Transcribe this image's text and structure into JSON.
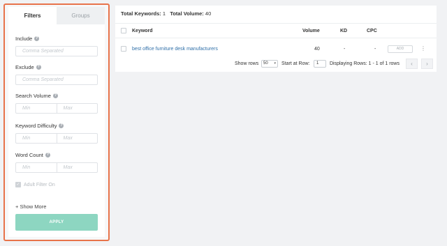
{
  "filters": {
    "tabs": [
      {
        "label": "Filters",
        "active": true
      },
      {
        "label": "Groups",
        "active": false
      }
    ],
    "include": {
      "label": "Include",
      "placeholder": "Comma Separated"
    },
    "exclude": {
      "label": "Exclude",
      "placeholder": "Comma Separated"
    },
    "search_volume": {
      "label": "Search Volume",
      "min": "Min",
      "max": "Max"
    },
    "keyword_difficulty": {
      "label": "Keyword Difficulty",
      "min": "Min",
      "max": "Max"
    },
    "word_count": {
      "label": "Word Count",
      "min": "Min",
      "max": "Max"
    },
    "adult_filter": {
      "label": "Adult Filter On",
      "checked": true
    },
    "show_more": "+ Show More",
    "apply": "APPLY",
    "help_icon": "?"
  },
  "summary": {
    "total_keywords_label": "Total Keywords:",
    "total_keywords": "1",
    "total_volume_label": "Total Volume:",
    "total_volume": "40"
  },
  "table": {
    "columns": {
      "keyword": "Keyword",
      "volume": "Volume",
      "kd": "KD",
      "cpc": "CPC"
    },
    "rows": [
      {
        "keyword": "best office furniture desk manufacturers",
        "volume": "40",
        "kd": "-",
        "cpc": "-",
        "action": "ADD"
      }
    ]
  },
  "pager": {
    "show_rows_label": "Show rows",
    "rows_per_page": "50",
    "start_label": "Start at Row:",
    "start_row": "1",
    "displaying": "Displaying Rows: 1 - 1 of 1 rows"
  },
  "colors": {
    "panel_border": "#e8734a",
    "apply_button": "#8dd6c1",
    "link": "#2f6fa8"
  },
  "icons": [
    "help-icon",
    "checkbox-checked-icon",
    "chevron-down-icon",
    "prev-page-icon",
    "next-page-icon",
    "kebab-menu-icon"
  ]
}
